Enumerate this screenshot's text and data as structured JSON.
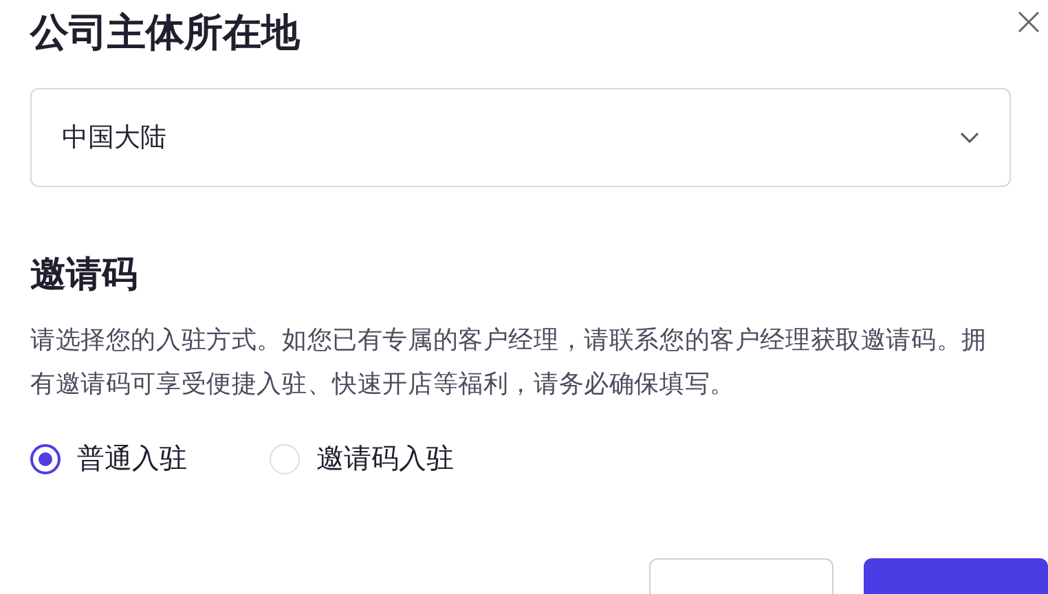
{
  "dialog": {
    "title": "公司主体所在地"
  },
  "location_select": {
    "value": "中国大陆"
  },
  "invite_section": {
    "title": "邀请码",
    "description": "请选择您的入驻方式。如您已有专属的客户经理，请联系您的客户经理获取邀请码。拥有邀请码可享受便捷入驻、快速开店等福利，请务必确保填写。",
    "options": [
      {
        "label": "普通入驻",
        "selected": true
      },
      {
        "label": "邀请码入驻",
        "selected": false
      }
    ]
  },
  "buttons": [
    {
      "kind": "secondary"
    },
    {
      "kind": "primary"
    }
  ]
}
